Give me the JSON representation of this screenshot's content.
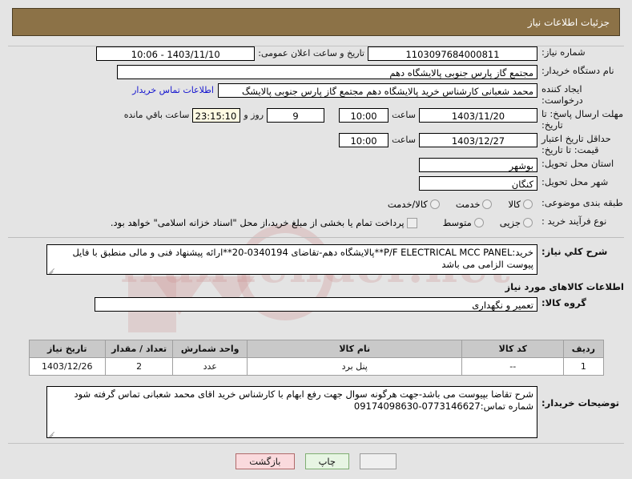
{
  "header": {
    "title": "جزئیات اطلاعات نیاز"
  },
  "form": {
    "need_number_label": "شماره نیاز:",
    "need_number_value": "1103097684000811",
    "announce_datetime_label": "تاریخ و ساعت اعلان عمومی:",
    "announce_datetime_value": "1403/11/10 - 10:06",
    "buyer_org_label": "نام دستگاه خریدار:",
    "buyer_org_value": "مجتمع گاز پارس جنوبی  پالایشگاه دهم",
    "creator_label": "ایجاد کننده درخواست:",
    "creator_value": "محمد شعبانی کارشناس خرید پالایشگاه دهم  مجتمع گاز پارس جنوبی  پالایشگ",
    "contact_link": "اطلاعات تماس خریدار",
    "response_deadline_label": "مهلت ارسال پاسخ: تا تاریخ:",
    "response_deadline_date": "1403/11/20",
    "hour_label": "ساعت",
    "response_deadline_hour": "10:00",
    "days_remaining": "9",
    "days_label": "روز و",
    "countdown": "23:15:10",
    "countdown_label": "ساعت باقي مانده",
    "price_validity_label": "حداقل تاریخ اعتبار قیمت: تا تاریخ:",
    "price_validity_date": "1403/12/27",
    "price_validity_hour": "10:00",
    "province_label": "استان محل تحویل:",
    "province_value": "بوشهر",
    "city_label": "شهر محل تحویل:",
    "city_value": "کنگان",
    "classification_label": "طبقه بندی موضوعی:",
    "classification_options": [
      "کالا",
      "خدمت",
      "کالا/خدمت"
    ],
    "classification_selected": "",
    "purchase_type_label": "نوع فرآیند خرید :",
    "purchase_type_options": [
      "جزیی",
      "متوسط"
    ],
    "purchase_type_selected": "",
    "treasury_checkbox_label": "پرداخت تمام یا بخشی از مبلغ خرید،از محل \"اسناد خزانه اسلامی\" خواهد بود.",
    "treasury_checked": false,
    "summary_label": "شرح کلي نیاز:",
    "summary_value": "خرید:P/F ELECTRICAL MCC PANEL**پالایشگاه دهم-تقاضای 0340194-20**ارائه پیشنهاد فنی و مالی منطبق با فایل پیوست الزامی می باشد",
    "goods_section_title": "اطلاعات کالاهای مورد نیاز",
    "goods_group_label": "گروه کالا:",
    "goods_group_value": "تعمیر و نگهداری",
    "buyer_notes_label": "توضیحات خریدار:",
    "buyer_notes_value": "شرح تقاضا بپیوست می باشد-جهت هرگونه سوال جهت رفع ابهام با کارشناس خرید اقای محمد شعبانی تماس گرفته شود شماره تماس:0773146627-09174098630"
  },
  "items_table": {
    "columns": [
      "ردیف",
      "کد کالا",
      "نام کالا",
      "واحد شمارش",
      "تعداد / مقدار",
      "تاریخ نیاز"
    ],
    "rows": [
      [
        "1",
        "--",
        "پنل برد",
        "عدد",
        "2",
        "1403/12/26"
      ]
    ]
  },
  "footer": {
    "back_button": "بازگشت",
    "print_button": "چاپ",
    "blank_button": ""
  },
  "watermark": {
    "text": "iranTender.net"
  },
  "colors": {
    "header_bg": "#8c7247",
    "page_bg": "#e4e4e4",
    "link": "#1515cf",
    "table_header_bg": "#c9c9c9",
    "cream_field": "#fffbe3",
    "back_button": "#fadadd",
    "print_button": "#e7f5e3"
  }
}
